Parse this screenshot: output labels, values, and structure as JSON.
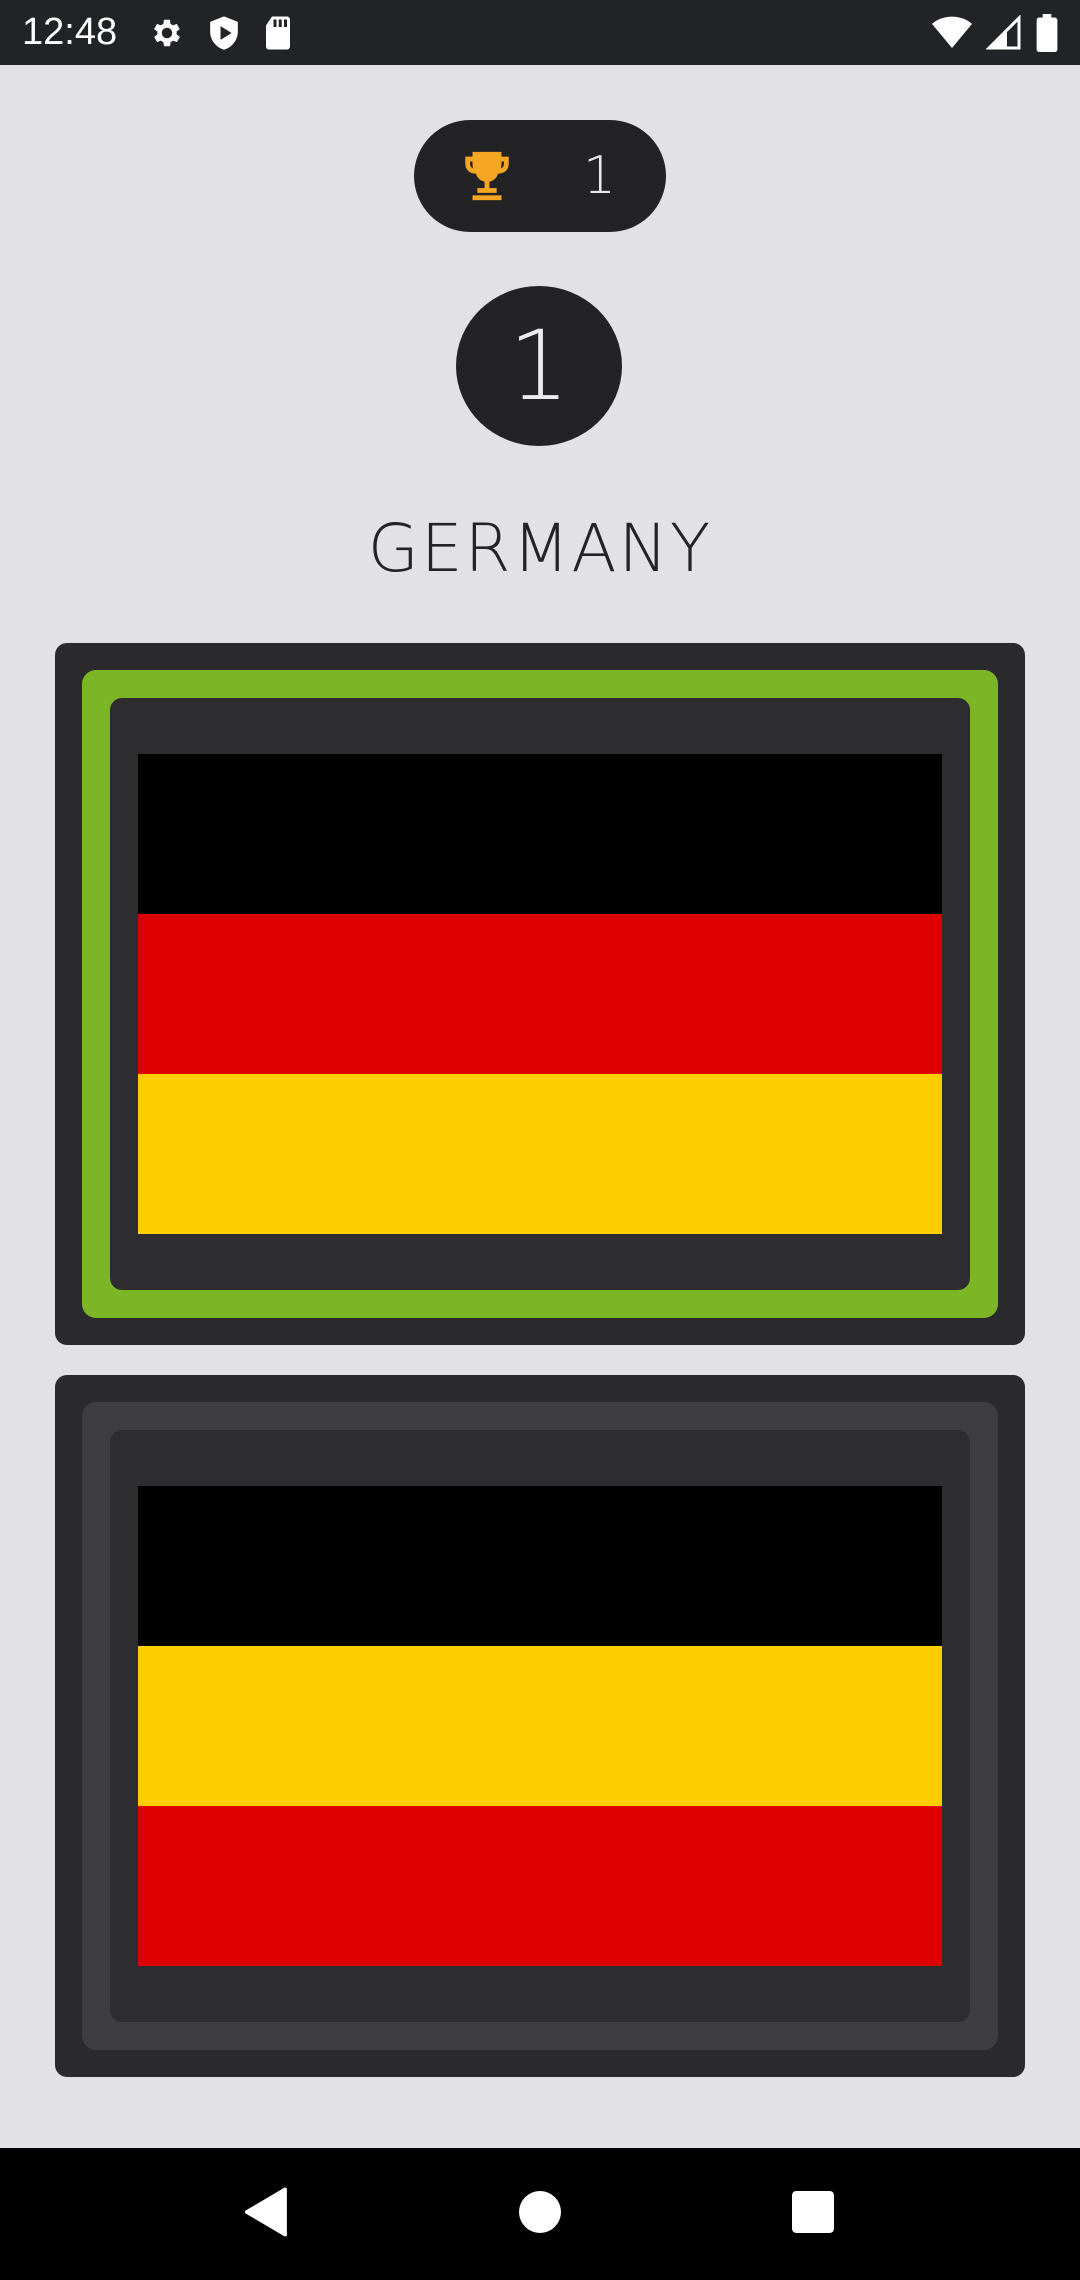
{
  "status_bar": {
    "time": "12:48",
    "icons_left": [
      "gear-icon",
      "shield-play-icon",
      "sd-card-icon"
    ],
    "icons_right": [
      "wifi-icon",
      "cell-signal-icon",
      "battery-icon"
    ]
  },
  "score": {
    "icon": "trophy-icon",
    "value": "1",
    "icon_color": "#f5a623"
  },
  "level": {
    "value": "1"
  },
  "question": {
    "country": "GERMANY"
  },
  "options": [
    {
      "state": "correct",
      "ring_color": "#7cb526",
      "stripes": [
        "#000000",
        "#dd0000",
        "#ffce00"
      ]
    },
    {
      "state": "neutral",
      "ring_color": "#3e3e41",
      "stripes": [
        "#000000",
        "#ffce00",
        "#dd0000"
      ]
    }
  ],
  "nav_bar": {
    "back": "back-icon",
    "home": "home-icon",
    "recents": "recents-icon"
  }
}
